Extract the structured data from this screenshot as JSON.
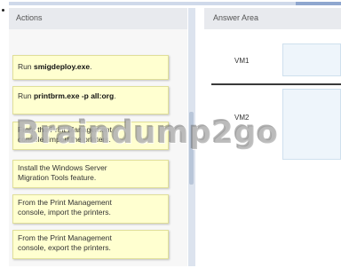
{
  "actions": {
    "title": "Actions",
    "items": [
      {
        "prefix": "Run ",
        "bold": "smigdeploy.exe",
        "suffix": ".",
        "line2": ""
      },
      {
        "prefix": "Run ",
        "bold": "printbrm.exe -p all:org",
        "suffix": ".",
        "line2": ""
      },
      {
        "prefix": "From the Print Management",
        "bold": "",
        "suffix": "",
        "line2": "console, import the printers."
      },
      {
        "prefix": "Install the Windows Server",
        "bold": "",
        "suffix": "",
        "line2": "Migration Tools feature."
      },
      {
        "prefix": "From the Print Management",
        "bold": "",
        "suffix": "",
        "line2": "console, import the printers."
      },
      {
        "prefix": "From the Print Management",
        "bold": "",
        "suffix": "",
        "line2": "console, export the printers."
      }
    ]
  },
  "answer_area": {
    "title": "Answer Area",
    "vm1_label": "VM1",
    "vm2_label": "VM2"
  },
  "watermark": "Braindump2go"
}
